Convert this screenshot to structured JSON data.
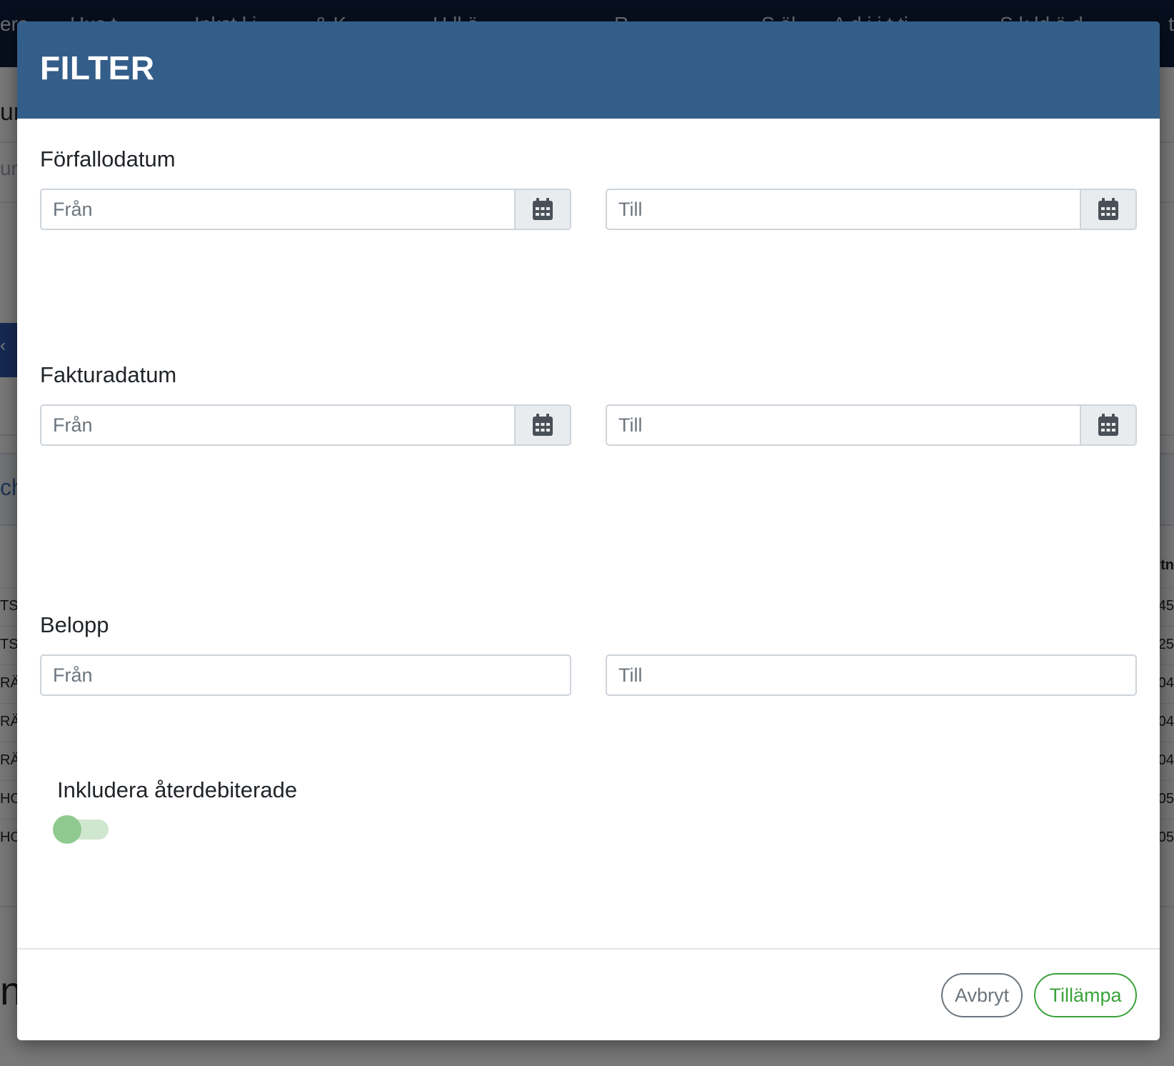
{
  "background": {
    "nav": {
      "items": [
        "era",
        "Hus t",
        "Inkst l i",
        "& K",
        "H ll ä",
        "R",
        "S öl",
        "A d i i t ti",
        "S k ld ä d",
        "t"
      ]
    },
    "heading_fragment": "ur",
    "field_fragment": "ura",
    "blue_tab_mark": "‹",
    "panel_text_fragment": "ch",
    "column_header_fragment": "tn",
    "rows": [
      {
        "left": "TS",
        "right": "45"
      },
      {
        "left": "TS",
        "right": "25"
      },
      {
        "left": "RÄ",
        "right": "04"
      },
      {
        "left": "RÄ",
        "right": "04"
      },
      {
        "left": "RÄ",
        "right": "04"
      },
      {
        "left": "HO",
        "right": "05"
      },
      {
        "left": "HO",
        "right": "05"
      }
    ],
    "bottom_fragment": "n"
  },
  "modal": {
    "title": "FILTER",
    "due_date": {
      "label": "Förfallodatum",
      "from_placeholder": "Från",
      "to_placeholder": "Till"
    },
    "invoice_date": {
      "label": "Fakturadatum",
      "from_placeholder": "Från",
      "to_placeholder": "Till"
    },
    "amount": {
      "label": "Belopp",
      "from_placeholder": "Från",
      "to_placeholder": "Till"
    },
    "include_recharged": {
      "label": "Inkludera återdebiterade",
      "enabled": false
    },
    "footer": {
      "cancel_label": "Avbryt",
      "apply_label": "Tillämpa"
    }
  },
  "icons": {
    "calendar": "calendar-icon"
  },
  "colors": {
    "header": "#345e8a",
    "nav": "#0f1f3d",
    "apply": "#3aa23a",
    "cancel": "#6c757d",
    "toggle_knob": "#8fc98f"
  }
}
